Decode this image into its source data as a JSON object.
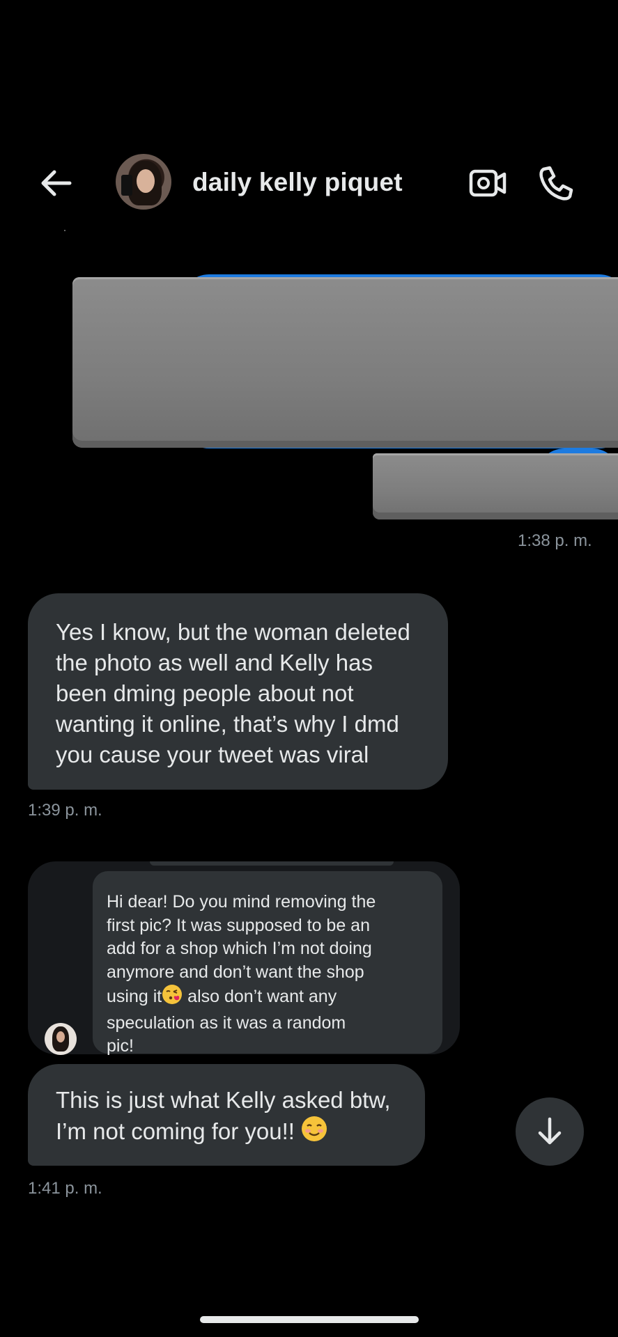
{
  "header": {
    "contact_name": "daily kelly piquet",
    "icons": {
      "back": "arrow-left-icon",
      "video": "video-camera-icon",
      "call": "phone-icon"
    }
  },
  "messages": [
    {
      "direction": "outgoing",
      "redacted": true,
      "timestamp": "1:38 p. m."
    },
    {
      "direction": "incoming",
      "text": "Yes I know, but the woman deleted the photo as well and Kelly has been dming people about not wanting it online, that’s why I dmd you cause your tweet was viral",
      "lines": [
        "Yes I know, but the woman deleted",
        "the photo as well and Kelly has",
        "been dming people about not",
        "wanting it online, that’s why I dmd",
        "you cause your tweet was viral"
      ],
      "timestamp": "1:39 p. m."
    },
    {
      "direction": "incoming",
      "type": "shared-message",
      "quoted_lines": [
        "Hi dear! Do you mind removing the",
        "first pic? It was supposed to be an",
        "add for a shop which I’m not doing",
        "anymore and don’t want the shop",
        "using it",
        " also don’t want any",
        "speculation as it was a random",
        "pic!"
      ],
      "emoji": "face-blowing-kiss-emoji"
    },
    {
      "direction": "incoming",
      "lines": [
        "This is just what Kelly asked btw,",
        "I’m not coming for you!!"
      ],
      "emoji": "smiling-face-emoji",
      "timestamp": "1:41 p. m."
    }
  ],
  "colors": {
    "background": "#000000",
    "bubble_incoming": "#2f3336",
    "text_primary": "#e7e9ea",
    "text_secondary": "#8b949c",
    "accent": "#1d9bf0"
  }
}
